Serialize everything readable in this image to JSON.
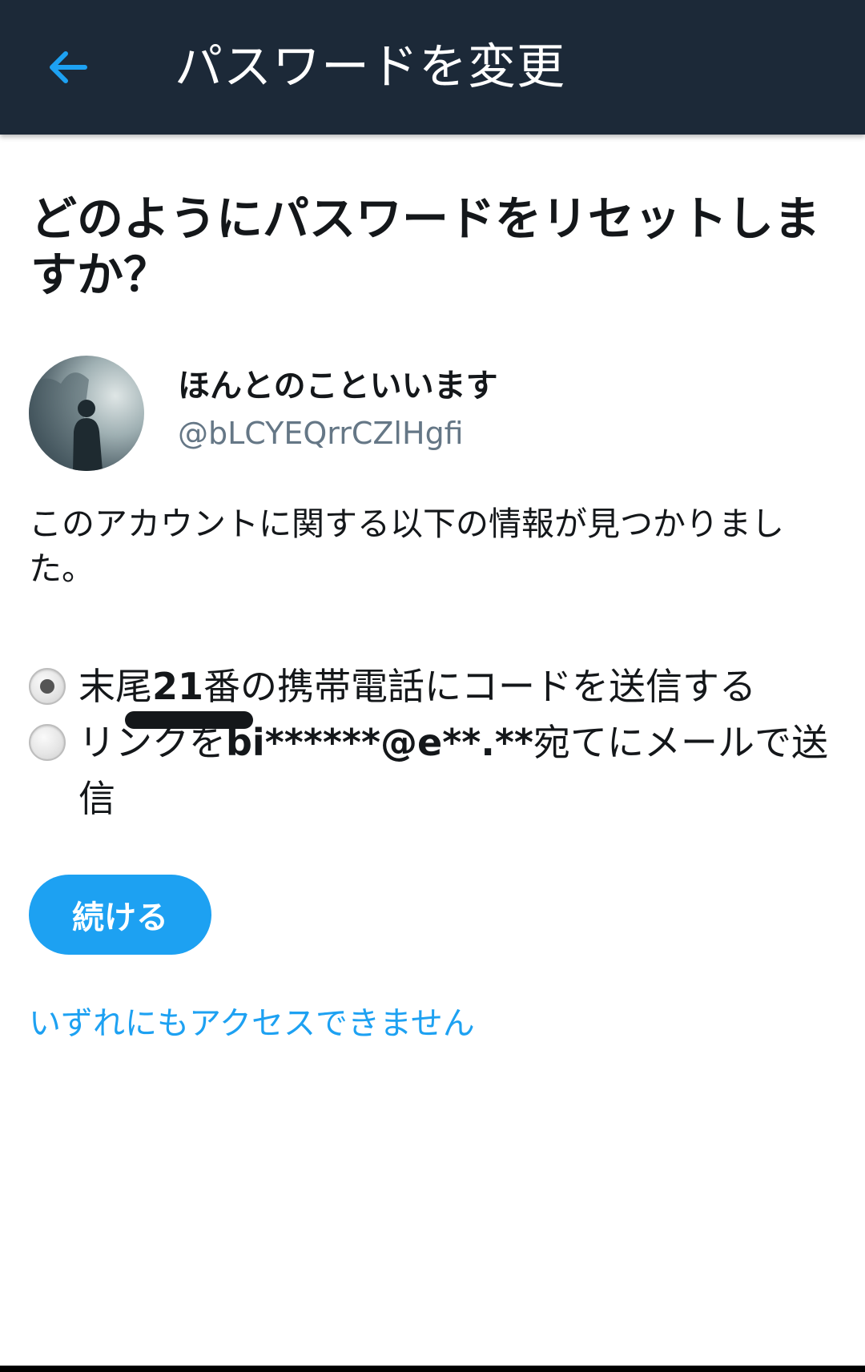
{
  "topbar": {
    "title": "パスワードを変更",
    "back_icon": "arrow-left-icon"
  },
  "heading": "どのようにパスワードをリセットしますか？",
  "profile": {
    "display_name": "ほんとのこといいます",
    "screen_name": "@bLCYEQrrCZlHgfi"
  },
  "description": "このアカウントに関する以下の情報が見つかりました。",
  "options": {
    "phone": {
      "prefix": "末尾",
      "digits": "21",
      "suffix": "番の携帯電話にコードを送信する",
      "selected": true
    },
    "email": {
      "prefix": "リンクを",
      "masked": "bi******@e**.**",
      "suffix": "宛てにメールで送信",
      "selected": false
    }
  },
  "continue_label": "続ける",
  "no_access_link": "いずれにもアクセスできません",
  "colors": {
    "topbar": "#1c2938",
    "accent": "#1da1f2",
    "text": "#14171a",
    "muted": "#657786"
  }
}
